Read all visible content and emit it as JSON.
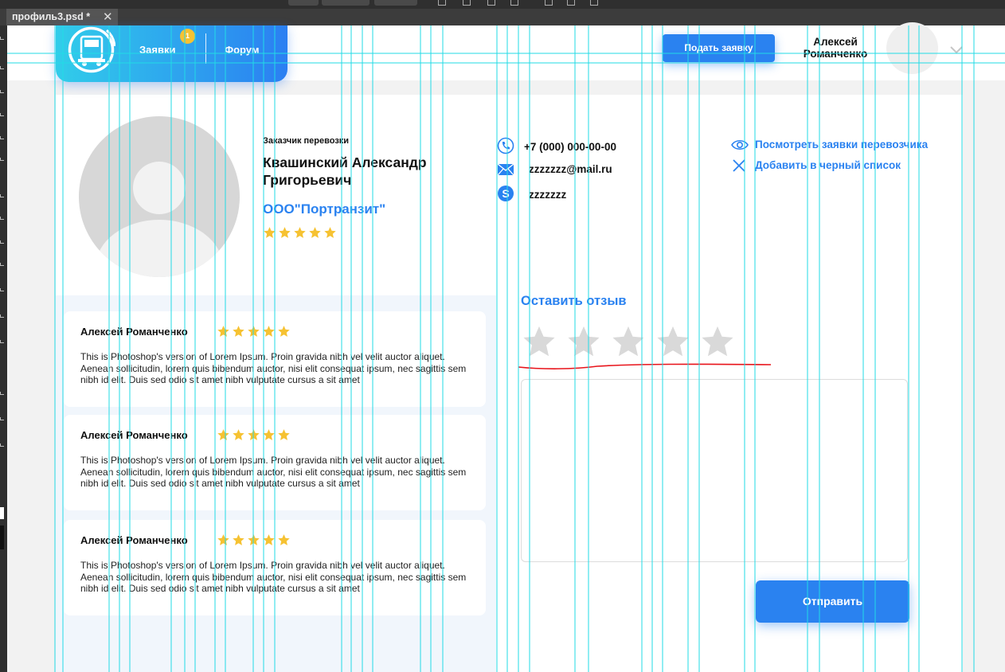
{
  "editor": {
    "file_tab": "профиль3.psd *",
    "tab_close": "✕"
  },
  "header": {
    "nav": {
      "requests": "Заявки",
      "forum": "Форум"
    },
    "badge": "1",
    "apply_button": "Подать заявку",
    "user_name_line1": "Алексей",
    "user_name_line2": "Романченко"
  },
  "profile": {
    "customer_type": "Заказчик перевозки",
    "name_line1": "Квашинский Александр",
    "name_line2": "Григорьевич",
    "company": "ООО\"Портранзит\"",
    "rating": 5
  },
  "contacts": {
    "phone": "+7 (000) 000-00-00",
    "email": "zzzzzzz@mail.ru",
    "skype": "zzzzzzz"
  },
  "actions": {
    "view_requests": "Посмотреть заявки перевозчика",
    "blacklist": "Добавить в черный список"
  },
  "reviews": [
    {
      "author": "Алексей Романченко",
      "rating": 5,
      "text": "This is Photoshop's version  of Lorem Ipsum. Proin gravida nibh vel velit auctor aliquet. Aenean sollicitudin, lorem quis bibendum auctor, nisi elit consequat ipsum, nec sagittis sem nibh id elit. Duis sed odio sit amet nibh vulputate cursus a sit amet"
    },
    {
      "author": "Алексей Романченко",
      "rating": 5,
      "text": "This is Photoshop's version  of Lorem Ipsum. Proin gravida nibh vel velit auctor aliquet. Aenean sollicitudin, lorem quis bibendum auctor, nisi elit consequat ipsum, nec sagittis sem nibh id elit. Duis sed odio sit amet nibh vulputate cursus a sit amet"
    },
    {
      "author": "Алексей Романченко",
      "rating": 5,
      "text": "This is Photoshop's version  of Lorem Ipsum. Proin gravida nibh vel velit auctor aliquet. Aenean sollicitudin, lorem quis bibendum auctor, nisi elit consequat ipsum, nec sagittis sem nibh id elit. Duis sed odio sit amet nibh vulputate cursus a sit amet"
    }
  ],
  "leave_review": {
    "title": "Оставить отзыв",
    "rating": 0,
    "text": "",
    "submit": "Отправить"
  },
  "colors": {
    "accent": "#2a82f0",
    "accent_light": "#31cdea",
    "star_gold": "#f6c232",
    "star_empty": "#d9d9d9",
    "guide": "#22dbe6",
    "annotation": "#e8141b"
  }
}
